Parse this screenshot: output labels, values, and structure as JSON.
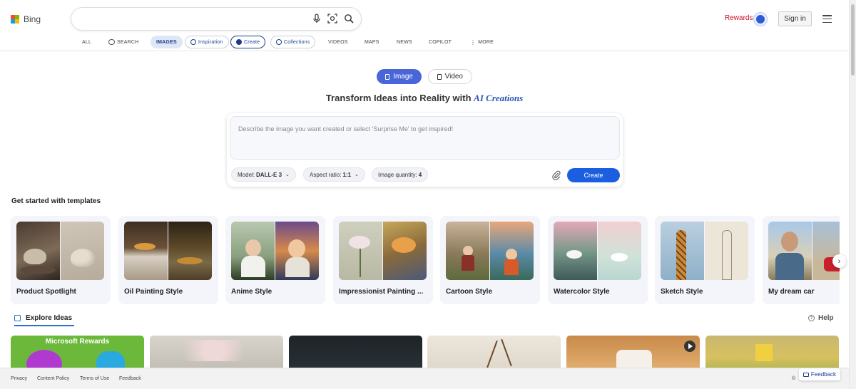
{
  "header": {
    "logo_text": "Bing",
    "rewards_label": "Rewards",
    "signin_label": "Sign in"
  },
  "nav": {
    "all": "ALL",
    "search": "SEARCH",
    "images": "IMAGES",
    "inspiration": "Inspiration",
    "create": "Create",
    "collections": "Collections",
    "videos": "VIDEOS",
    "maps": "MAPS",
    "news": "NEWS",
    "copilot": "COPILOT",
    "more": "MORE"
  },
  "toggle": {
    "image": "Image",
    "video": "Video"
  },
  "heading": {
    "text": "Transform Ideas into Reality with",
    "accent": "AI Creations"
  },
  "prompt": {
    "placeholder": "Describe the image you want created or select 'Surprise Me' to get inspired!",
    "model_label": "Model:",
    "model_value": "DALL-E 3",
    "aspect_label": "Aspect ratio:",
    "aspect_value": "1:1",
    "quantity_label": "Image quantity:",
    "quantity_value": "4",
    "create_label": "Create"
  },
  "templates": {
    "title": "Get started with templates",
    "items": [
      {
        "label": "Product Spotlight"
      },
      {
        "label": "Oil Painting Style"
      },
      {
        "label": "Anime Style"
      },
      {
        "label": "Impressionist Painting ..."
      },
      {
        "label": "Cartoon Style"
      },
      {
        "label": "Watercolor Style"
      },
      {
        "label": "Sketch Style"
      },
      {
        "label": "My dream car"
      }
    ]
  },
  "explore": {
    "title": "Explore Ideas",
    "help": "Help",
    "rewards_tile": "Microsoft Rewards"
  },
  "footer": {
    "privacy": "Privacy",
    "content_policy": "Content Policy",
    "terms": "Terms of Use",
    "feedback": "Feedback",
    "copyright": "©",
    "feedback_button": "Feedback"
  },
  "colors": {
    "accent": "#4a65d8",
    "create_button": "#1b5fe0",
    "rewards_text": "#c50f1f"
  }
}
